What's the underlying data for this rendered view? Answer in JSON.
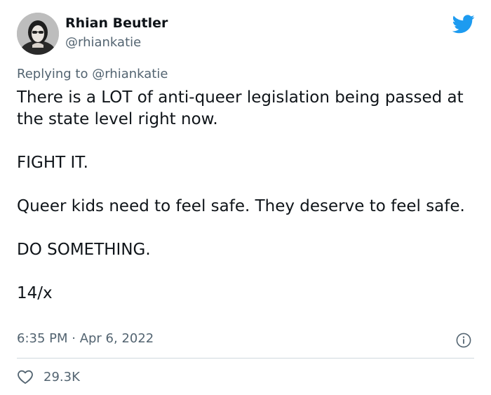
{
  "author": {
    "display_name": "Rhian Beutler",
    "handle": "@rhiankatie"
  },
  "reply": {
    "prefix": "Replying to ",
    "mention": "@rhiankatie"
  },
  "tweet": {
    "paragraphs": [
      "There is a LOT of anti-queer legislation being passed at the state level right now.",
      "FIGHT IT.",
      "Queer kids need to feel safe. They deserve to feel safe.",
      "DO SOMETHING.",
      "14/x"
    ],
    "timestamp": "6:35 PM · Apr 6, 2022"
  },
  "engagement": {
    "likes": "29.3K"
  },
  "icons": {
    "logo": "twitter-bird-icon",
    "info": "info-icon",
    "like": "heart-icon"
  },
  "colors": {
    "brand": "#1d9bf0",
    "secondary_text": "#536471",
    "primary_text": "#0f1419"
  }
}
